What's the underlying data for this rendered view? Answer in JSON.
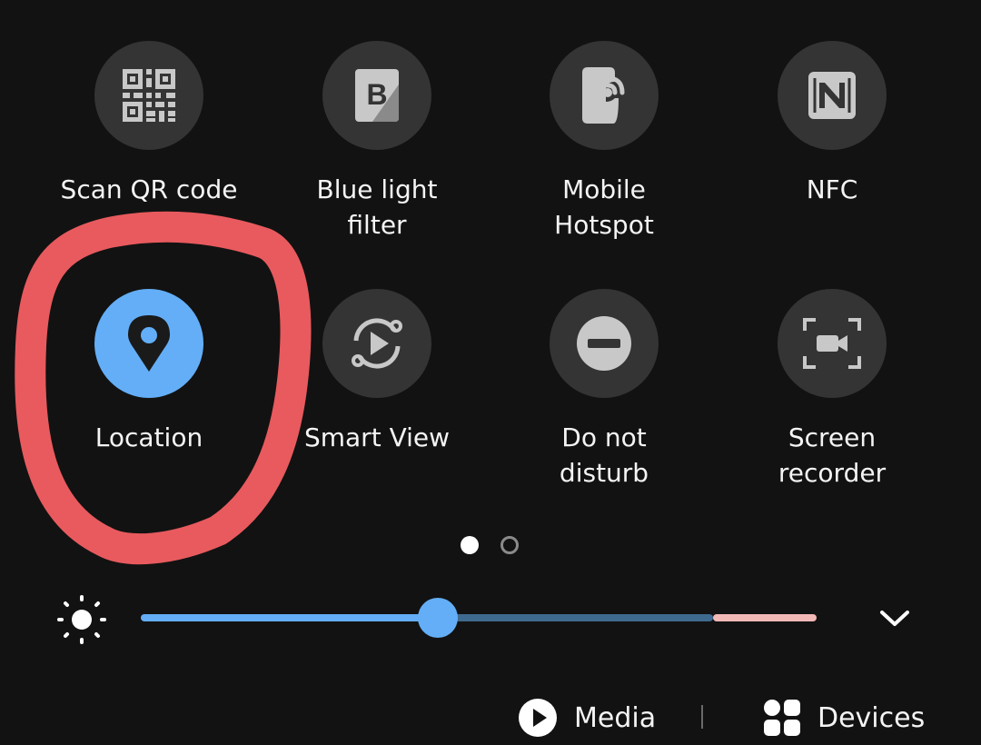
{
  "quick_panel": {
    "tiles": [
      {
        "label": "Scan QR code",
        "icon": "qr-code-icon",
        "active": false
      },
      {
        "label": "Blue light\nfilter",
        "icon": "blue-light-filter-icon",
        "active": false
      },
      {
        "label": "Mobile\nHotspot",
        "icon": "mobile-hotspot-icon",
        "active": false
      },
      {
        "label": "NFC",
        "icon": "nfc-icon",
        "active": false
      },
      {
        "label": "Location",
        "icon": "location-pin-icon",
        "active": true
      },
      {
        "label": "Smart View",
        "icon": "smart-view-icon",
        "active": false
      },
      {
        "label": "Do not\ndisturb",
        "icon": "do-not-disturb-icon",
        "active": false
      },
      {
        "label": "Screen\nrecorder",
        "icon": "screen-recorder-icon",
        "active": false
      }
    ],
    "page_indicator": {
      "current_page": 1,
      "total_pages": 2
    },
    "brightness": {
      "icon": "brightness-sun-icon",
      "level": 0.44,
      "expand_icon": "chevron-down-icon"
    },
    "bottom_bar": {
      "media": {
        "label": "Media",
        "icon": "play-circle-icon"
      },
      "devices": {
        "label": "Devices",
        "icon": "devices-grid-icon"
      }
    }
  },
  "annotation": {
    "shape": "hand-drawn-circle",
    "color": "#e85a5e",
    "target": "Location"
  },
  "colors": {
    "background": "#121212",
    "tile_off": "#343434",
    "tile_on": "#63aef7",
    "icon_off": "#c8c8c8",
    "slider_track": "#3f6a8f",
    "slider_warm_end": "#f2b8b6"
  }
}
